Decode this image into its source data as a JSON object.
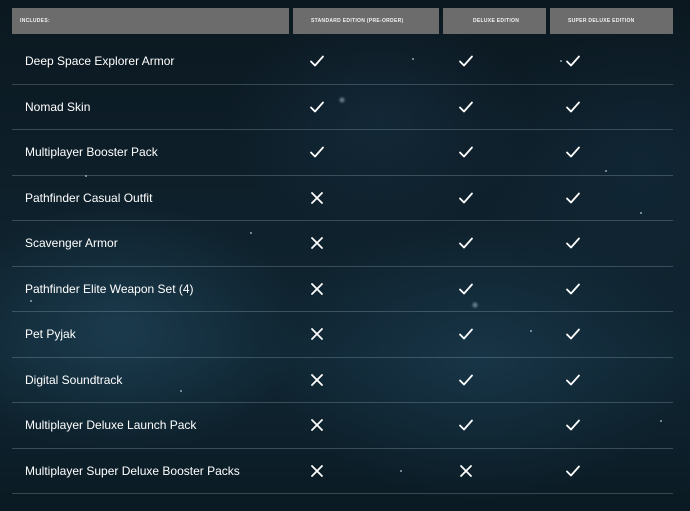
{
  "header": {
    "columns": [
      "INCLUDES:",
      "STANDARD EDITION (PRE-ORDER)",
      "DELUXE EDITION",
      "SUPER DELUXE EDITION"
    ]
  },
  "rows": [
    {
      "label": "Deep Space Explorer Armor",
      "marks": [
        "check",
        "check",
        "check"
      ]
    },
    {
      "label": "Nomad Skin",
      "marks": [
        "check",
        "check",
        "check"
      ]
    },
    {
      "label": "Multiplayer Booster Pack",
      "marks": [
        "check",
        "check",
        "check"
      ]
    },
    {
      "label": "Pathfinder Casual Outfit",
      "marks": [
        "cross",
        "check",
        "check"
      ]
    },
    {
      "label": "Scavenger Armor",
      "marks": [
        "cross",
        "check",
        "check"
      ]
    },
    {
      "label": "Pathfinder Elite Weapon Set (4)",
      "marks": [
        "cross",
        "check",
        "check"
      ]
    },
    {
      "label": "Pet Pyjak",
      "marks": [
        "cross",
        "check",
        "check"
      ]
    },
    {
      "label": "Digital Soundtrack",
      "marks": [
        "cross",
        "check",
        "check"
      ]
    },
    {
      "label": "Multiplayer Deluxe Launch Pack",
      "marks": [
        "cross",
        "check",
        "check"
      ]
    },
    {
      "label": "Multiplayer Super Deluxe Booster Packs",
      "marks": [
        "cross",
        "cross",
        "check"
      ]
    }
  ],
  "colors": {
    "header_bg": "#6c6c6c",
    "text": "#ffffff",
    "divider": "#aabec8"
  }
}
